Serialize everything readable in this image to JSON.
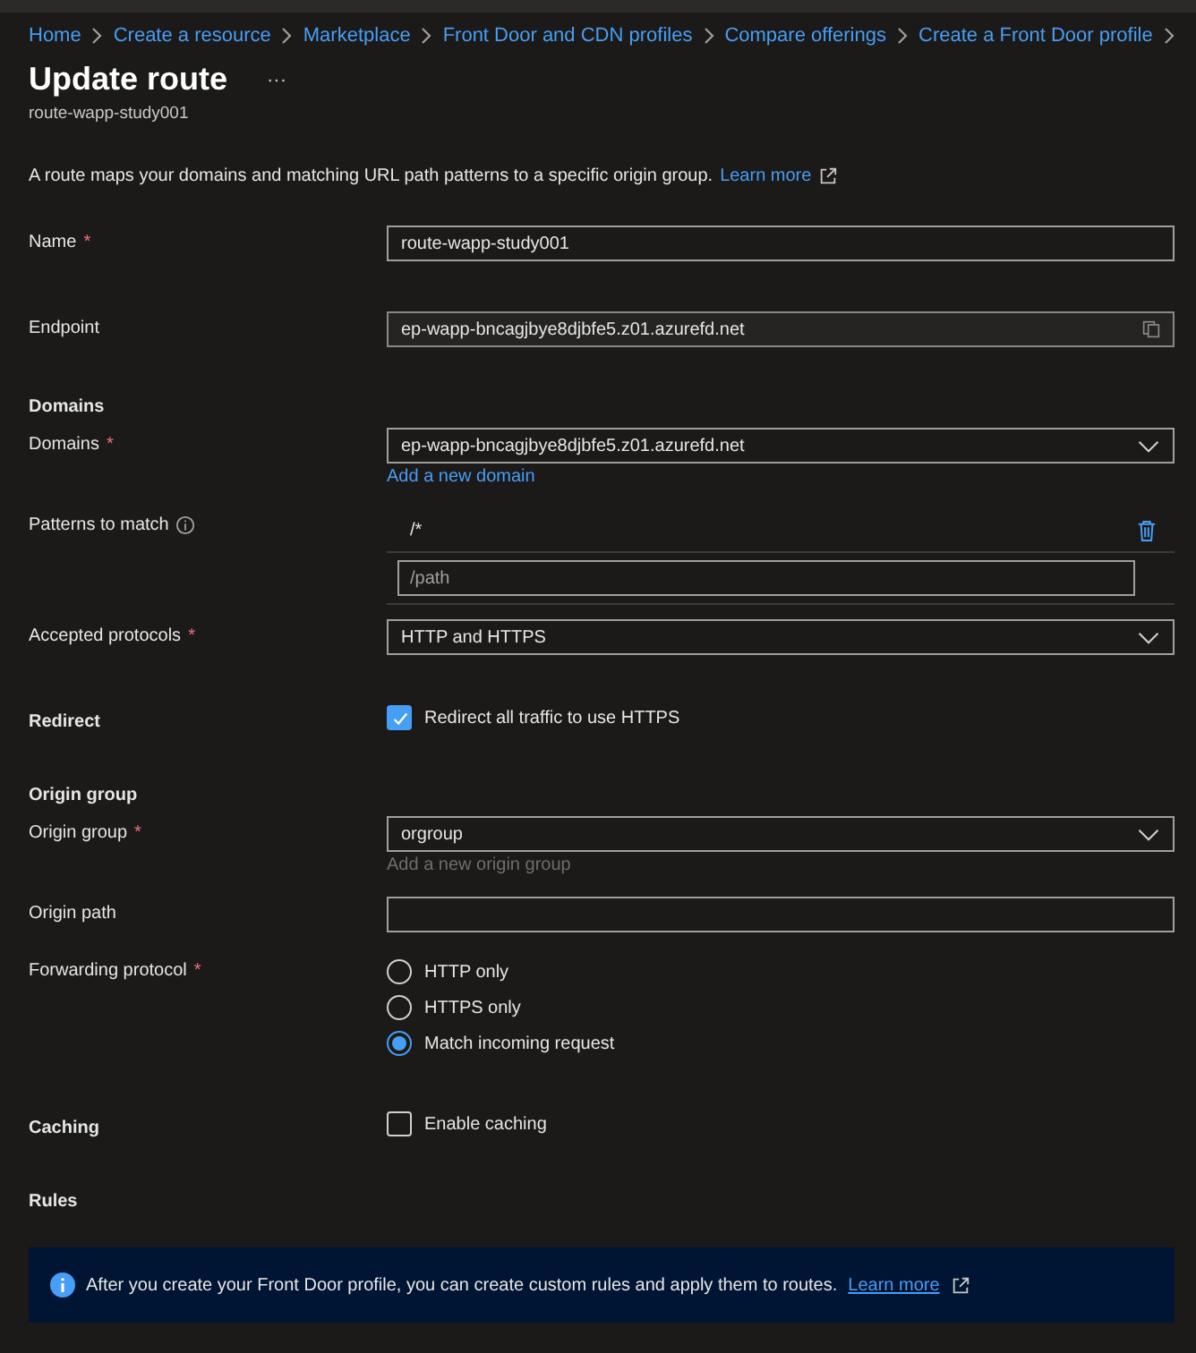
{
  "breadcrumbs": [
    "Home",
    "Create a resource",
    "Marketplace",
    "Front Door and CDN profiles",
    "Compare offerings",
    "Create a Front Door profile"
  ],
  "title": "Update route",
  "more": "···",
  "subtitle": "route-wapp-study001",
  "description": {
    "text": "A route maps your domains and matching URL path patterns to a specific origin group.",
    "link": "Learn more"
  },
  "fields": [
    {
      "kind": "text",
      "label": "Name",
      "required_mark": "*",
      "value": "route-wapp-study001"
    },
    {
      "kind": "readonly",
      "label": "Endpoint",
      "value": "ep-wapp-bncagjbye8djbfe5.z01.azurefd.net"
    },
    {
      "kind": "heading",
      "label": "Domains"
    },
    {
      "kind": "dropdown",
      "label": "Domains",
      "required_mark": "*",
      "value": "ep-wapp-bncagjbye8djbfe5.z01.azurefd.net",
      "link": {
        "text": "Add a new domain",
        "disabled": false
      }
    },
    {
      "kind": "patterns",
      "label": "Patterns to match",
      "info": true,
      "patterns": [
        "/*"
      ],
      "placeholder": "/path"
    },
    {
      "kind": "dropdown",
      "label": "Accepted protocols",
      "required_mark": "*",
      "value": "HTTP and HTTPS"
    },
    {
      "kind": "checkbox",
      "label": "Redirect",
      "option": "Redirect all traffic to use HTTPS",
      "checked": true
    },
    {
      "kind": "heading",
      "label": "Origin group"
    },
    {
      "kind": "dropdown",
      "label": "Origin group",
      "required_mark": "*",
      "value": "orgroup",
      "link": {
        "text": "Add a new origin group",
        "disabled": true
      }
    },
    {
      "kind": "text",
      "label": "Origin path"
    },
    {
      "kind": "radio",
      "label": "Forwarding protocol",
      "required_mark": "*",
      "options": [
        {
          "label": "HTTP only",
          "selected": false
        },
        {
          "label": "HTTPS only",
          "selected": false
        },
        {
          "label": "Match incoming request",
          "selected": true
        }
      ]
    },
    {
      "kind": "checkbox",
      "label": "Caching",
      "option": "Enable caching",
      "checked": false
    },
    {
      "kind": "heading",
      "label": "Rules"
    }
  ],
  "banner": {
    "text": "After you create your Front Door profile, you can create custom rules and apply them to routes.",
    "link": "Learn more"
  }
}
